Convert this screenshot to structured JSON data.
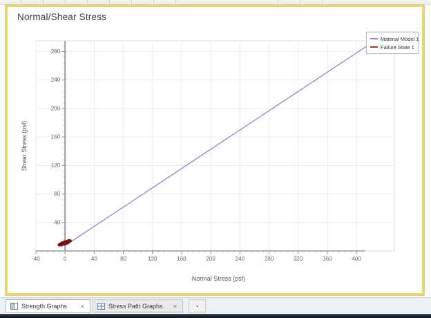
{
  "window": {
    "title": "Normal/Shear Stress"
  },
  "legend": {
    "items": [
      {
        "label": "Material Model 1",
        "color": "#9187c6"
      },
      {
        "label": "Failure State 1",
        "color": "#9a3f3b"
      }
    ]
  },
  "chart_data": {
    "type": "line",
    "title": "Normal/Shear Stress",
    "xlabel": "Normal Stress (psf)",
    "ylabel": "Shear Stress (psf)",
    "xlim": [
      -40,
      452
    ],
    "ylim": [
      0,
      295
    ],
    "x_ticks": [
      -40,
      0,
      40,
      80,
      120,
      160,
      200,
      240,
      280,
      320,
      360,
      400
    ],
    "y_ticks": [
      40,
      80,
      120,
      160,
      200,
      240,
      280
    ],
    "minor_tick_step": 8,
    "grid": true,
    "legend_position": "top-right",
    "series": [
      {
        "name": "Material Model 1",
        "type": "line",
        "color": "#9187c6",
        "points": [
          [
            0,
            7.5
          ],
          [
            437,
            303
          ]
        ]
      },
      {
        "name": "Failure State 1",
        "type": "scatter",
        "color": "#701013",
        "points": [
          [
            -8,
            8.5
          ],
          [
            -7,
            9.3
          ],
          [
            -6,
            9.2
          ],
          [
            -5,
            9.8
          ],
          [
            -4,
            10.2
          ],
          [
            -3,
            10.4
          ],
          [
            -2,
            10.8
          ],
          [
            -1,
            11.2
          ],
          [
            0,
            11.4
          ],
          [
            1,
            11.8
          ],
          [
            2,
            12.2
          ],
          [
            3,
            12.4
          ],
          [
            4,
            12.9
          ],
          [
            5,
            13.3
          ],
          [
            6,
            13.8
          ],
          [
            7,
            14.2
          ],
          [
            -5,
            8.6
          ],
          [
            -2,
            9.6
          ],
          [
            1,
            10.4
          ],
          [
            4,
            11.6
          ],
          [
            -4,
            11.4
          ],
          [
            -1,
            12.3
          ],
          [
            2,
            13.3
          ],
          [
            5,
            14.4
          ]
        ]
      }
    ]
  },
  "tabs": [
    {
      "label": "Strength Graphs",
      "close_label": "×",
      "active": true,
      "icon": "split-pane-icon"
    },
    {
      "label": "Stress Path Graphs",
      "close_label": "×",
      "active": false,
      "icon": "grid-pane-icon"
    }
  ],
  "tab_bar": {
    "add_label": "▪"
  }
}
